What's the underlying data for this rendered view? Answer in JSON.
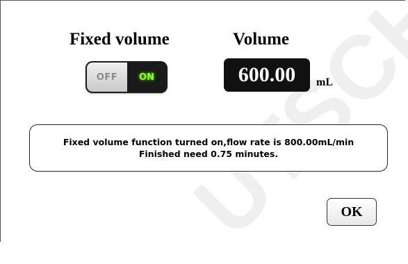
{
  "dialog": {
    "fixed_volume_label": "Fixed volume",
    "volume_label": "Volume",
    "toggle": {
      "off_label": "OFF",
      "on_label": "ON",
      "state": "on"
    },
    "volume_value": "600.00",
    "volume_unit": "mL",
    "message_line1": "Fixed volume function turned on,flow rate is 800.00mL/min",
    "message_line2": "Finished need 0.75 minutes.",
    "ok_label": "OK"
  },
  "colors": {
    "toggle_on_text": "#8dff2a",
    "volume_box_bg": "#111111",
    "watermark": "#f2f2f2"
  }
}
